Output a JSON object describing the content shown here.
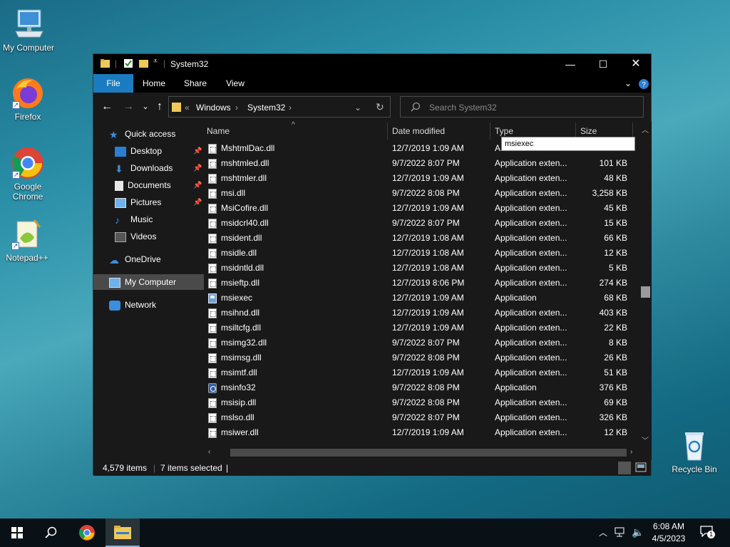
{
  "desktop": {
    "icons": [
      {
        "label": "My Computer"
      },
      {
        "label": "Firefox"
      },
      {
        "label": "Google Chrome"
      },
      {
        "label": "Notepad++"
      },
      {
        "label": "Recycle Bin"
      }
    ]
  },
  "window": {
    "title": "System32",
    "ribbon_tabs": [
      "File",
      "Home",
      "Share",
      "View"
    ],
    "address": {
      "overflow": "«",
      "crumbs": [
        "Windows",
        "System32"
      ]
    },
    "search_placeholder": "Search System32",
    "nav": {
      "quick_access": "Quick access",
      "items": [
        "Desktop",
        "Downloads",
        "Documents",
        "Pictures",
        "Music",
        "Videos"
      ],
      "onedrive": "OneDrive",
      "my_computer": "My Computer",
      "network": "Network"
    },
    "columns": {
      "name": "Name",
      "date": "Date modified",
      "type": "Type",
      "size": "Size"
    },
    "tooltip": "msiexec",
    "files": [
      {
        "name": "MshtmlDac.dll",
        "date": "12/7/2019 1:09 AM",
        "type": "A",
        "size": "",
        "icon": "dll"
      },
      {
        "name": "mshtmled.dll",
        "date": "9/7/2022 8:07 PM",
        "type": "Application exten...",
        "size": "101 KB",
        "icon": "dll"
      },
      {
        "name": "mshtmler.dll",
        "date": "12/7/2019 1:09 AM",
        "type": "Application exten...",
        "size": "48 KB",
        "icon": "dll"
      },
      {
        "name": "msi.dll",
        "date": "9/7/2022 8:08 PM",
        "type": "Application exten...",
        "size": "3,258 KB",
        "icon": "dll"
      },
      {
        "name": "MsiCofire.dll",
        "date": "12/7/2019 1:09 AM",
        "type": "Application exten...",
        "size": "45 KB",
        "icon": "dll"
      },
      {
        "name": "msidcrl40.dll",
        "date": "9/7/2022 8:07 PM",
        "type": "Application exten...",
        "size": "15 KB",
        "icon": "dll"
      },
      {
        "name": "msident.dll",
        "date": "12/7/2019 1:08 AM",
        "type": "Application exten...",
        "size": "66 KB",
        "icon": "dll"
      },
      {
        "name": "msidle.dll",
        "date": "12/7/2019 1:08 AM",
        "type": "Application exten...",
        "size": "12 KB",
        "icon": "dll"
      },
      {
        "name": "msidntld.dll",
        "date": "12/7/2019 1:08 AM",
        "type": "Application exten...",
        "size": "5 KB",
        "icon": "dll"
      },
      {
        "name": "msieftp.dll",
        "date": "12/7/2019 8:06 PM",
        "type": "Application exten...",
        "size": "274 KB",
        "icon": "dll"
      },
      {
        "name": "msiexec",
        "date": "12/7/2019 1:09 AM",
        "type": "Application",
        "size": "68 KB",
        "icon": "app"
      },
      {
        "name": "msihnd.dll",
        "date": "12/7/2019 1:09 AM",
        "type": "Application exten...",
        "size": "403 KB",
        "icon": "dll"
      },
      {
        "name": "msiltcfg.dll",
        "date": "12/7/2019 1:09 AM",
        "type": "Application exten...",
        "size": "22 KB",
        "icon": "dll"
      },
      {
        "name": "msimg32.dll",
        "date": "9/7/2022 8:07 PM",
        "type": "Application exten...",
        "size": "8 KB",
        "icon": "dll"
      },
      {
        "name": "msimsg.dll",
        "date": "9/7/2022 8:08 PM",
        "type": "Application exten...",
        "size": "26 KB",
        "icon": "dll"
      },
      {
        "name": "msimtf.dll",
        "date": "12/7/2019 1:09 AM",
        "type": "Application exten...",
        "size": "51 KB",
        "icon": "dll"
      },
      {
        "name": "msinfo32",
        "date": "9/7/2022 8:08 PM",
        "type": "Application",
        "size": "376 KB",
        "icon": "info"
      },
      {
        "name": "msisip.dll",
        "date": "9/7/2022 8:08 PM",
        "type": "Application exten...",
        "size": "69 KB",
        "icon": "dll"
      },
      {
        "name": "mslso.dll",
        "date": "9/7/2022 8:07 PM",
        "type": "Application exten...",
        "size": "326 KB",
        "icon": "dll"
      },
      {
        "name": "msiwer.dll",
        "date": "12/7/2019 1:09 AM",
        "type": "Application exten...",
        "size": "12 KB",
        "icon": "dll"
      }
    ],
    "status": {
      "items": "4,579 items",
      "selected": "7 items selected"
    }
  },
  "taskbar": {
    "time": "6:08 AM",
    "date": "4/5/2023",
    "notification_count": "1"
  }
}
